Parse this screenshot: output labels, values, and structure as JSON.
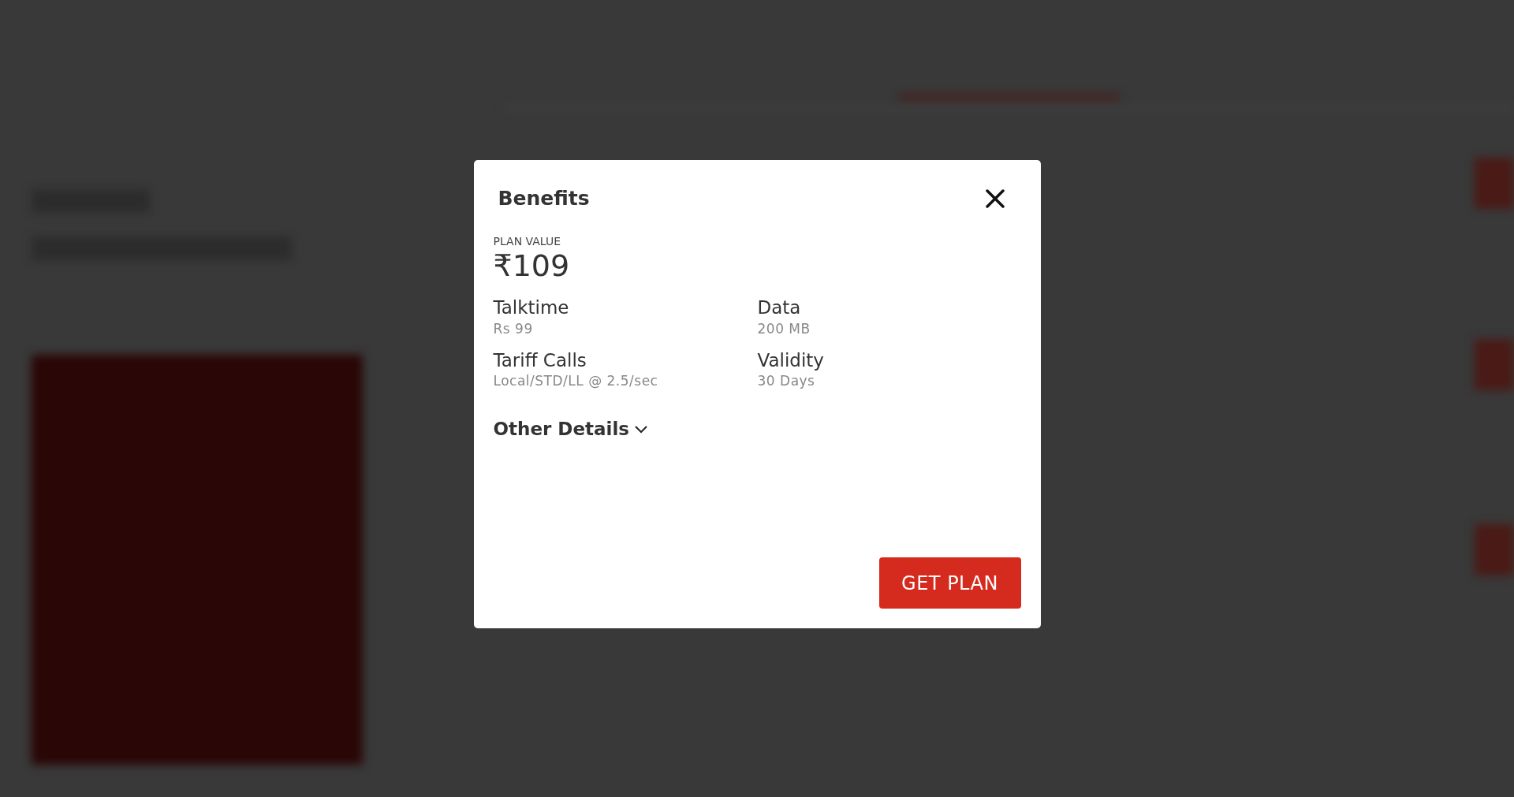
{
  "modal": {
    "title": "Benefits",
    "plan_value_label": "PLAN VALUE",
    "plan_value": "₹109",
    "benefits": [
      {
        "label": "Talktime",
        "value": "Rs 99"
      },
      {
        "label": "Data",
        "value": "200 MB"
      },
      {
        "label": "Tariff Calls",
        "value": "Local/STD/LL @ 2.5/sec"
      },
      {
        "label": "Validity",
        "value": "30 Days"
      }
    ],
    "other_details": {
      "label": "Other Details",
      "expanded": false
    },
    "button": "GET PLAN"
  }
}
